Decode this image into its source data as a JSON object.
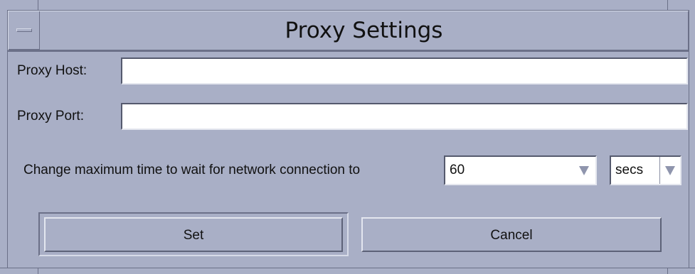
{
  "window": {
    "title": "Proxy Settings",
    "menu_icon": "window-menu-icon"
  },
  "form": {
    "proxy_host_label": "Proxy Host:",
    "proxy_host_value": "",
    "proxy_port_label": "Proxy Port:",
    "proxy_port_value": "",
    "timeout_label": "Change maximum time to wait for network connection to",
    "timeout_value": "60",
    "timeout_unit": "secs",
    "dropdown_icon": "triangle-down-icon"
  },
  "buttons": {
    "set_label": "Set",
    "cancel_label": "Cancel"
  },
  "colors": {
    "background": "#a9afc6",
    "field_background": "#ffffff",
    "text": "#111111"
  }
}
